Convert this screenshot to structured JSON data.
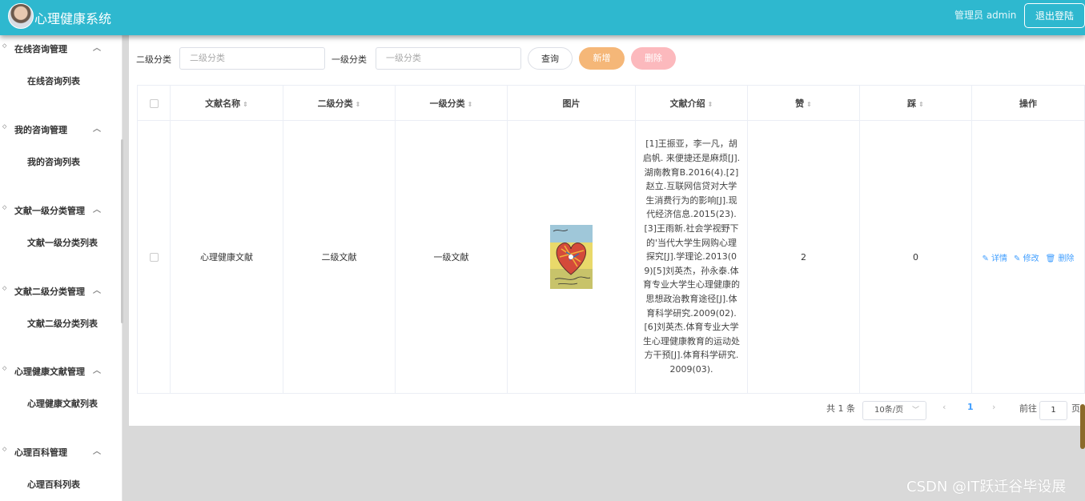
{
  "header": {
    "title": "心理健康系统",
    "user_label": "管理员 admin",
    "logout_label": "退出登陆",
    "accent_color": "#2eb8cf"
  },
  "sidebar": {
    "groups": [
      {
        "label": "在线咨询管理",
        "items": [
          {
            "label": "在线咨询列表"
          }
        ]
      },
      {
        "label": "我的咨询管理",
        "items": [
          {
            "label": "我的咨询列表"
          }
        ]
      },
      {
        "label": "文献一级分类管理",
        "items": [
          {
            "label": "文献一级分类列表"
          }
        ]
      },
      {
        "label": "文献二级分类管理",
        "items": [
          {
            "label": "文献二级分类列表"
          }
        ]
      },
      {
        "label": "心理健康文献管理",
        "items": [
          {
            "label": "心理健康文献列表"
          }
        ]
      },
      {
        "label": "心理百科管理",
        "items": [
          {
            "label": "心理百科列表"
          }
        ]
      }
    ]
  },
  "search": {
    "level2_label": "二级分类",
    "level2_placeholder": "二级分类",
    "level1_label": "一级分类",
    "level1_placeholder": "一级分类",
    "query_label": "查询",
    "add_label": "新增",
    "delete_label": "删除"
  },
  "table": {
    "columns": [
      "文献名称",
      "二级分类",
      "一级分类",
      "图片",
      "文献介绍",
      "赞",
      "踩",
      "操作"
    ],
    "rows": [
      {
        "name": "心理健康文献",
        "level2": "二级文献",
        "level1": "一级文献",
        "intro": "[1]王振亚，李一凡，胡启帆.                来便捷还是麻烦[J].湖南教育B.2016(4).[2]赵立.互联网信贷对大学生消费行为的影响[J].现代经济信息.2015(23).[3]王雨新.社会学视野下的'当代大学生网购心理探究[J].学理论.2013(09)[5]刘英杰，孙永泰.体育专业大学生心理健康的思想政治教育途径[J].体育科学研究.2009(02).[6]刘英杰.体育专业大学生心理健康教育的运动处方干预[J].体育科学研究.2009(03).",
        "likes": "2",
        "dislikes": "0",
        "actions": {
          "detail": "详情",
          "edit": "修改",
          "delete": "删除"
        }
      }
    ]
  },
  "pagination": {
    "total_label": "共 1 条",
    "page_size_label": "10条/页",
    "current_page": "1",
    "goto_label": "前往",
    "goto_value": "1",
    "page_suffix": "页"
  },
  "watermark": "CSDN @IT跃迁谷毕设展"
}
